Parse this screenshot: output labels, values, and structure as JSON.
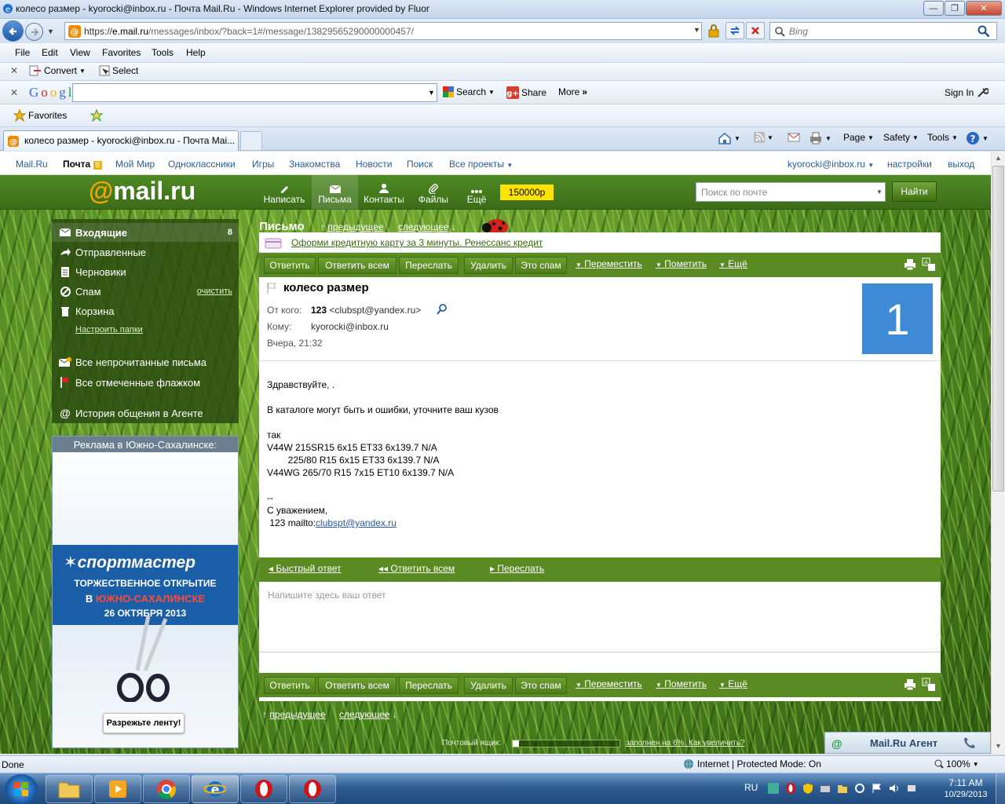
{
  "window": {
    "title": "колесо размер - kyorocki@inbox.ru - Почта Mail.Ru - Windows Internet Explorer provided by Fluor"
  },
  "browser": {
    "url_prefix": "https://",
    "url_host": "e.mail.ru",
    "url_path": "/messages/inbox/?back=1#/message/13829565290000000457/",
    "search_placeholder": "Bing",
    "menu": [
      "File",
      "Edit",
      "View",
      "Favorites",
      "Tools",
      "Help"
    ],
    "convert": "Convert",
    "select": "Select",
    "google_search": "Search",
    "google_share": "Share",
    "google_more": "More",
    "google_signin": "Sign In",
    "favorites": "Favorites",
    "tab_title": "колесо размер - kyorocki@inbox.ru - Почта Mai...",
    "cmd": {
      "page": "Page",
      "safety": "Safety",
      "tools": "Tools"
    }
  },
  "topnav": {
    "mailru": "Mail.Ru",
    "pochta": "Почта",
    "pochta_count": "8",
    "moimir": "Мой Мир",
    "odnoklassniki": "Одноклассники",
    "igry": "Игры",
    "znakomstva": "Знакомства",
    "novosti": "Новости",
    "poisk": "Поиск",
    "all": "Все проекты",
    "user": "kyorocki@inbox.ru",
    "settings": "настройки",
    "exit": "выход"
  },
  "header": {
    "logo_at": "@",
    "logo_text": "mail.ru",
    "write": "Написать",
    "letters": "Письма",
    "contacts": "Контакты",
    "files": "Файлы",
    "more": "Ещё",
    "balance": "150000р",
    "search_placeholder": "Поиск по почте",
    "search_button": "Найти"
  },
  "sidebar": {
    "inbox": "Входящие",
    "inbox_count": "8",
    "sent": "Отправленные",
    "drafts": "Черновики",
    "spam": "Спам",
    "spam_clear": "очистить",
    "trash": "Корзина",
    "setup": "Настроить папки",
    "unread": "Все непрочитанные письма",
    "flagged": "Все отмеченные флажком",
    "agent_history": "История общения в Агенте"
  },
  "ad": {
    "title": "Реклама в Южно-Сахалинске:",
    "brand": "спортмастер",
    "line1": "ТОРЖЕСТВЕННОЕ ОТКРЫТИЕ",
    "line2a": "В ",
    "line2b": "ЮЖНО-САХАЛИНСКЕ",
    "line3": "26 ОКТЯБРЯ 2013",
    "button": "Разрежьте ленту!"
  },
  "message": {
    "section": "Письмо",
    "prev": "предыдущее",
    "next": "следующее",
    "promo": "Оформи кредитную карту за 3 минуты. Ренессанс кредит",
    "actions": {
      "reply": "Ответить",
      "reply_all": "Ответить всем",
      "forward": "Переслать",
      "delete": "Удалить",
      "spam": "Это спам",
      "move": "Переместить",
      "mark": "Пометить",
      "more": "Ещё"
    },
    "subject": "колесо размер",
    "from_label": "От кого:",
    "from_name": "123",
    "from_email": "<clubspt@yandex.ru>",
    "to_label": "Кому:",
    "to": "kyorocki@inbox.ru",
    "date": "Вчера, 21:32",
    "avatar": "1",
    "body": [
      "Здравствуйте, .",
      "В каталоге могут быть и ошибки, уточните ваш кузов",
      "так",
      "V44W 215SR15 6x15 ET33 6x139.7 N/A",
      "        225/80 R15 6x15 ET33 6x139.7 N/A",
      "V44WG 265/70 R15 7x15 ET10 6x139.7 N/A",
      "--",
      "С уважением,",
      " 123 mailto:"
    ],
    "body_link": "clubspt@yandex.ru",
    "quick_reply": "Быстрый ответ",
    "quick_reply_all": "Ответить всем",
    "quick_forward": "Переслать",
    "reply_placeholder": "Напишите здесь ваш ответ",
    "quota_label": "Почтовый ящик:",
    "quota_info": "заполнен на 6%. Как увеличить?",
    "agent": "Mail.Ru Агент"
  },
  "status": {
    "done": "Done",
    "zone": "Internet | Protected Mode: On",
    "zoom": "100%"
  },
  "taskbar": {
    "lang": "RU",
    "time": "7:11 AM",
    "date": "10/29/2013"
  }
}
